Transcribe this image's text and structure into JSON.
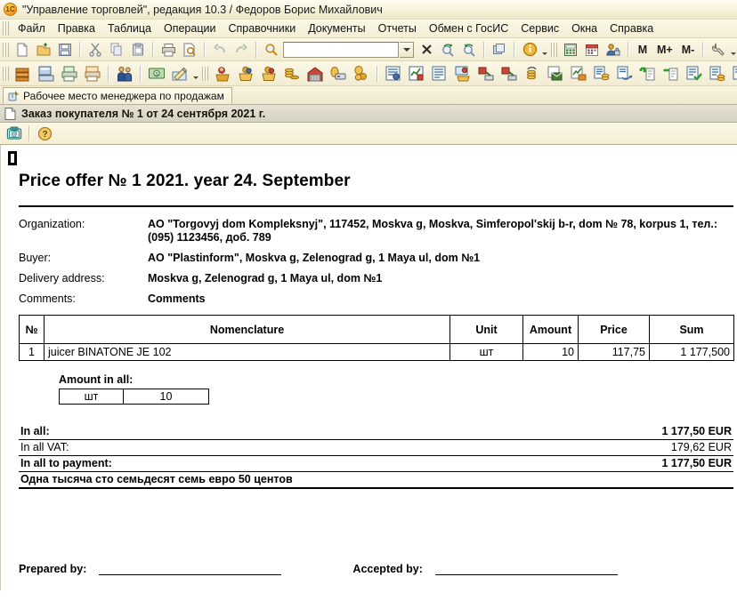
{
  "window": {
    "title": "\"Управление торговлей\", редакция 10.3 / Федоров Борис Михайлович",
    "logo_text": "1C"
  },
  "menubar": {
    "items": [
      {
        "label": "Файл",
        "accel": "Ф"
      },
      {
        "label": "Правка",
        "accel": "П"
      },
      {
        "label": "Таблица",
        "accel": ""
      },
      {
        "label": "Операции",
        "accel": ""
      },
      {
        "label": "Справочники",
        "accel": ""
      },
      {
        "label": "Документы",
        "accel": ""
      },
      {
        "label": "Отчеты",
        "accel": ""
      },
      {
        "label": "Обмен с ГосИС",
        "accel": ""
      },
      {
        "label": "Сервис",
        "accel": "С"
      },
      {
        "label": "Окна",
        "accel": "О"
      },
      {
        "label": "Справка",
        "accel": "п"
      }
    ]
  },
  "toolbar_main": {
    "memory_buttons": [
      "M",
      "M+",
      "M-"
    ],
    "search_value": "",
    "search_placeholder": ""
  },
  "tabstrip": {
    "tabs": [
      {
        "label": "Рабочее место менеджера по продажам",
        "active": true
      }
    ]
  },
  "document_window": {
    "title": "Заказ покупателя № 1 от 24 сентября 2021 г."
  },
  "report": {
    "title": "Price offer № 1  2021. year 24. September",
    "fields": [
      {
        "label": "Organization:",
        "value": "AO \"Torgovyj dom Kompleksnyj\", 117452, Moskva g, Moskva, Simferopol'skij b-r, dom № 78, korpus 1, тел.: (095) 1123456, доб. 789"
      },
      {
        "label": "Buyer:",
        "value": "AO \"Plastinform\", Moskva g, Zelenograd g, 1 Maya ul, dom №1"
      },
      {
        "label": "Delivery address:",
        "value": "Moskva g, Zelenograd g, 1 Maya ul, dom №1"
      },
      {
        "label": "Comments:",
        "value": "Comments"
      }
    ],
    "table": {
      "headers": [
        "№",
        "Nomenclature",
        "Unit",
        "Amount",
        "Price",
        "Sum"
      ],
      "rows": [
        {
          "no": "1",
          "nomenclature": "juicer  BINATONE JE 102",
          "unit": "шт",
          "amount": "10",
          "price": "117,75",
          "sum": "1 177,500"
        }
      ]
    },
    "amount_in_all": {
      "title": "Amount in all:",
      "unit": "шт",
      "quantity": "10"
    },
    "totals": [
      {
        "label": "In all:",
        "value": "1 177,50 EUR",
        "bold": true
      },
      {
        "label": "In all VAT:",
        "value": "179,62 EUR",
        "bold": false
      },
      {
        "label": "In all to payment:",
        "value": "1 177,50 EUR",
        "bold": true
      }
    ],
    "total_in_words": "Одна тысяча сто семьдесят семь евро 50 центов",
    "signatures": [
      {
        "label": "Prepared by:"
      },
      {
        "label": "Accepted by:"
      }
    ]
  }
}
